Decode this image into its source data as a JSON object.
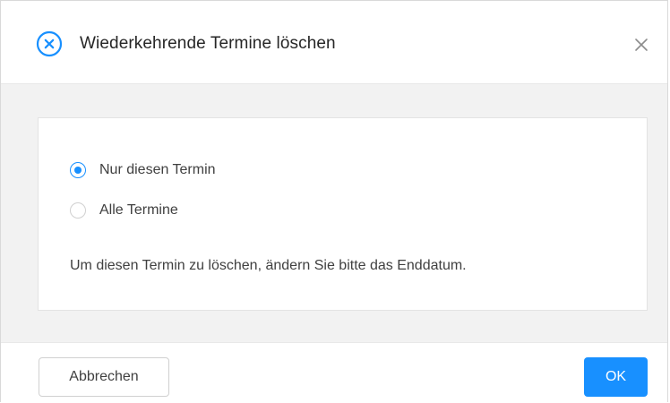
{
  "dialog": {
    "title": "Wiederkehrende Termine löschen",
    "title_icon": "close-circle-icon",
    "close_icon": "close-icon"
  },
  "options": [
    {
      "label": "Nur diesen Termin",
      "checked": true
    },
    {
      "label": "Alle Termine",
      "checked": false
    }
  ],
  "info_text": "Um diesen Termin zu löschen, ändern Sie bitte das Enddatum.",
  "footer": {
    "cancel_label": "Abbrechen",
    "ok_label": "OK"
  },
  "colors": {
    "accent": "#1890ff",
    "body_background": "#f2f2f2",
    "text": "#404040"
  }
}
